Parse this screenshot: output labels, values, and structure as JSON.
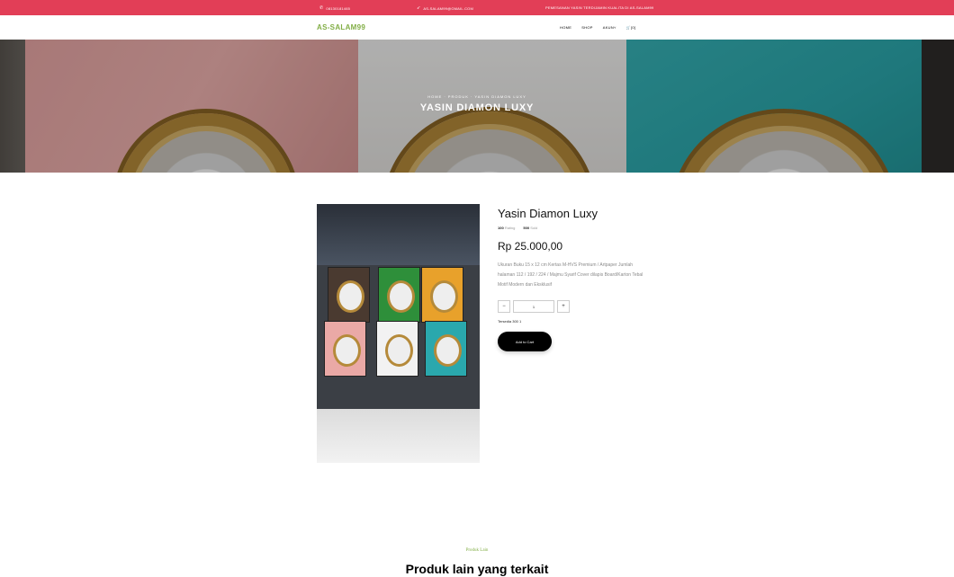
{
  "topbar": {
    "phone": "08130181465",
    "email": "AS-SALAM99@GMAIL.COM",
    "promo": "PEMESANAN YASIN TERDIJAMIN KUALITA DI AS-SALAM99",
    "color": "#e23e57"
  },
  "nav": {
    "brand": "AS-SALAM99",
    "items": [
      "HOME",
      "SHOP",
      "AKUN",
      "[0]"
    ]
  },
  "hero": {
    "breadcrumb": "HOME · PRODUK · YASIN DIAMON LUXY",
    "title": "YASIN DIAMON LUXY"
  },
  "product": {
    "name": "Yasin Diamon Luxy",
    "rating_value": "100",
    "rating_label": "Rating",
    "sold_value": "500",
    "sold_label": "Sold",
    "price": "Rp 25.000,00",
    "description": "Ukuran Buku 15 x 12 cm Kertas M-HVS Premium / Artpaper Jumlah halaman 112 / 192 / 224 / Majmu Syarif Cover dilapis Board/Karton Tebal Motif Modern dan Eksklusif",
    "quantity": "1",
    "minus": "−",
    "plus": "+",
    "stock": "Tersedia 300 ",
    "stock_count": "1",
    "cart_label": "Add to Cart"
  },
  "related": {
    "subtitle": "Produk Lain",
    "title": "Produk lain yang terkait"
  },
  "colors": {
    "accent": "#82ae46",
    "button": "#000000"
  },
  "icons": [
    "phone-icon",
    "paper-plane-icon",
    "cart-icon",
    "chevron-down-icon"
  ]
}
